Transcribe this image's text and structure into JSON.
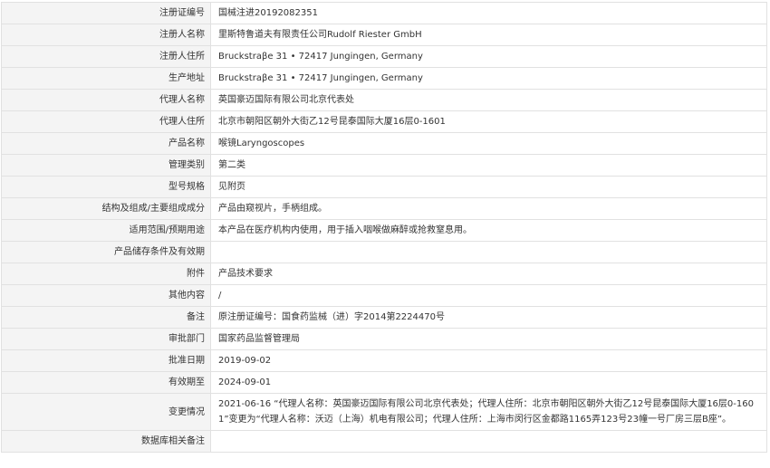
{
  "rows": [
    {
      "label": "注册证编号",
      "value": "国械注进20192082351"
    },
    {
      "label": "注册人名称",
      "value": "里斯特鲁道夫有限责任公司Rudolf Riester GmbH"
    },
    {
      "label": "注册人住所",
      "value": "Bruckstraβe 31 • 72417 Jungingen, Germany"
    },
    {
      "label": "生产地址",
      "value": "Bruckstraβe 31 • 72417 Jungingen, Germany"
    },
    {
      "label": "代理人名称",
      "value": "英国豪迈国际有限公司北京代表处"
    },
    {
      "label": "代理人住所",
      "value": "北京市朝阳区朝外大街乙12号昆泰国际大厦16层0-1601"
    },
    {
      "label": "产品名称",
      "value": "喉镜Laryngoscopes"
    },
    {
      "label": "管理类别",
      "value": "第二类"
    },
    {
      "label": "型号规格",
      "value": "见附页"
    },
    {
      "label": "结构及组成/主要组成成分",
      "value": "产品由窥视片，手柄组成。"
    },
    {
      "label": "适用范围/预期用途",
      "value": "本产品在医疗机构内使用，用于插入咽喉做麻醉或抢救窒息用。"
    },
    {
      "label": "产品储存条件及有效期",
      "value": ""
    },
    {
      "label": "附件",
      "value": "产品技术要求"
    },
    {
      "label": "其他内容",
      "value": "/"
    },
    {
      "label": "备注",
      "value": "原注册证编号：国食药监械（进）字2014第2224470号"
    },
    {
      "label": "审批部门",
      "value": "国家药品监督管理局"
    },
    {
      "label": "批准日期",
      "value": "2019-09-02"
    },
    {
      "label": "有效期至",
      "value": "2024-09-01"
    },
    {
      "label": "变更情况",
      "value": "2021-06-16 “代理人名称：英国豪迈国际有限公司北京代表处；代理人住所：北京市朝阳区朝外大街乙12号昆泰国际大厦16层0-1601”变更为“代理人名称：沃迈（上海）机电有限公司；代理人住所：上海市闵行区金都路1165弄123号23幢一号厂房三层B座”。"
    },
    {
      "label": "数据库相关备注",
      "value": ""
    }
  ]
}
